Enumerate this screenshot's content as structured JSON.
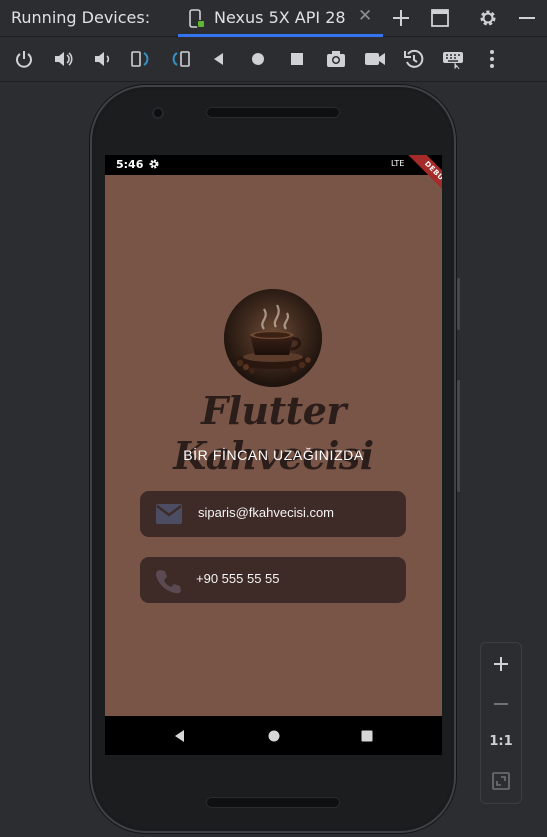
{
  "window": {
    "title": "Running Devices:",
    "tab_label": "Nexus 5X API 28",
    "close_symbol": "✕"
  },
  "top_icons": [
    "add-icon",
    "window-icon",
    "settings-icon",
    "minimize-icon"
  ],
  "toolbar_icons": [
    "power-icon",
    "volume-up-icon",
    "volume-down-icon",
    "rotate-left-icon",
    "rotate-right-icon",
    "back-icon",
    "home-icon",
    "overview-icon",
    "screenshot-icon",
    "screen-record-icon",
    "snapshot-icon",
    "keyboard-icon",
    "more-icon"
  ],
  "device": {
    "status_time": "5:46",
    "network": "LTE",
    "debug_label": "DEBUG"
  },
  "app": {
    "title": "Flutter Kahvecisi",
    "subtitle": "BİR FİNCAN UZAĞINIZDA",
    "email": "siparis@fkahvecisi.com",
    "phone": "+90 555 55 55",
    "background_color": "#795548",
    "card_color": "#3e2a26"
  },
  "zoom": {
    "actual_size_label": "1:1"
  }
}
